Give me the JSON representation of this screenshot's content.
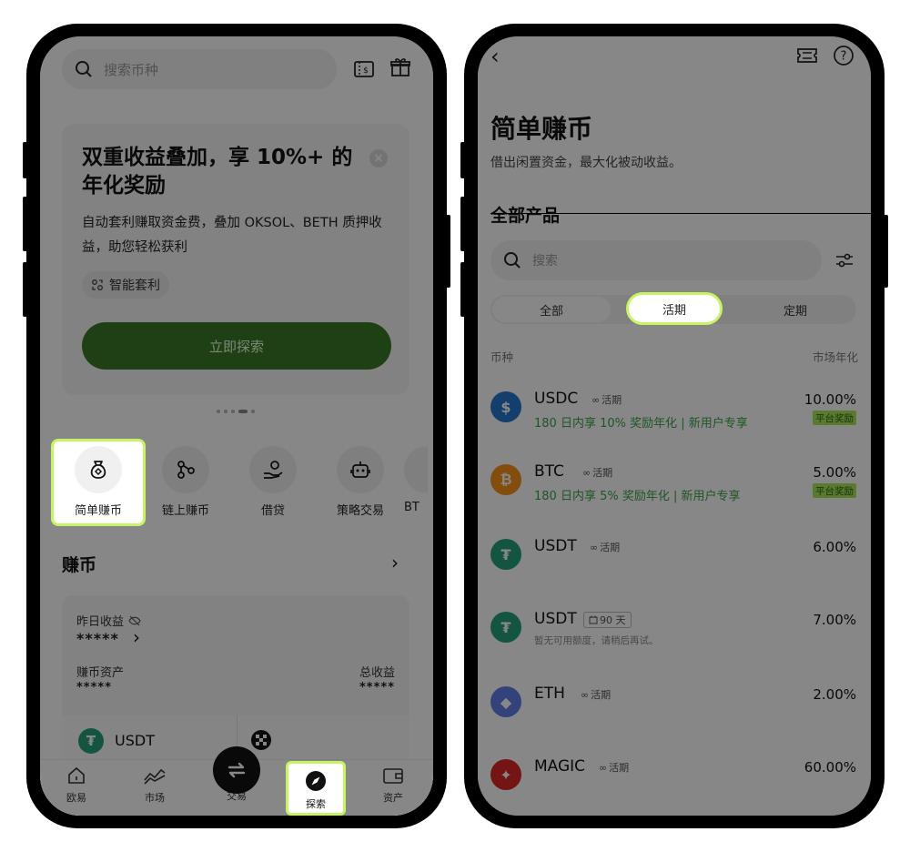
{
  "colors": {
    "highlight": "#c7f464",
    "brand_green": "#3c7a26",
    "green_text": "#3ba24b",
    "reward_bg": "#a6e85a",
    "usdc": "#2775ca",
    "btc": "#f7931a",
    "usdt": "#26a17b",
    "eth": "#627eea",
    "magic": "#dc2626"
  },
  "left": {
    "search": {
      "placeholder": "搜索币种",
      "icon": "search-icon"
    },
    "top_icons": [
      "voucher-icon",
      "gift-icon"
    ],
    "promo": {
      "title": "双重收益叠加，享 10%+ 的年化奖励",
      "desc": "自动套利赚取资金费，叠加 OKSOL、BETH 质押收益，助您轻松获利",
      "tag": "智能套利",
      "cta": "立即探索"
    },
    "features": [
      {
        "label": "简单赚币",
        "icon": "money-bag-icon"
      },
      {
        "label": "链上赚币",
        "icon": "chain-nodes-icon"
      },
      {
        "label": "借贷",
        "icon": "coin-hand-icon"
      },
      {
        "label": "策略交易",
        "icon": "robot-icon"
      },
      {
        "label": "BT"
      }
    ],
    "section": {
      "title": "赚币"
    },
    "card": {
      "yesterday_label": "昨日收益",
      "yesterday_value": "*****",
      "assets_label": "赚币资产",
      "assets_value": "*****",
      "total_label": "总收益",
      "total_value": "*****",
      "coin": "USDT"
    },
    "tabs": [
      {
        "label": "欧易",
        "icon": "home-icon"
      },
      {
        "label": "市场",
        "icon": "market-chart-icon"
      },
      {
        "label": "交易",
        "icon": "swap-icon"
      },
      {
        "label": "探索",
        "icon": "compass-icon"
      },
      {
        "label": "资产",
        "icon": "wallet-icon"
      }
    ]
  },
  "right": {
    "title": "简单赚币",
    "subtitle": "借出闲置资金，最大化被动收益。",
    "section": "全部产品",
    "search": {
      "placeholder": "搜索"
    },
    "segments": [
      "全部",
      "活期",
      "定期"
    ],
    "col_left": "币种",
    "col_right": "市场年化",
    "products": [
      {
        "name": "USDC",
        "badge": "活期",
        "badge_icon": "infinity-icon",
        "rate": "10.00%",
        "sub": "180 日内享 10% 奖励年化 | 新用户专享",
        "reward": "平台奖励",
        "color": "#2775ca",
        "glyph": "$"
      },
      {
        "name": "BTC",
        "badge": "活期",
        "badge_icon": "infinity-icon",
        "rate": "5.00%",
        "sub": "180 日内享 5% 奖励年化 | 新用户专享",
        "reward": "平台奖励",
        "color": "#f7931a",
        "glyph": "₿"
      },
      {
        "name": "USDT",
        "badge": "活期",
        "badge_icon": "infinity-icon",
        "rate": "6.00%",
        "color": "#26a17b",
        "glyph": "₮"
      },
      {
        "name": "USDT",
        "badge": "90 天",
        "badge_icon": "calendar-icon",
        "rate": "7.00%",
        "sub": "暂无可用额度，请稍后再试。",
        "color": "#26a17b",
        "glyph": "₮"
      },
      {
        "name": "ETH",
        "badge": "活期",
        "badge_icon": "infinity-icon",
        "rate": "2.00%",
        "color": "#627eea",
        "glyph": "◆"
      },
      {
        "name": "MAGIC",
        "badge": "活期",
        "badge_icon": "infinity-icon",
        "rate": "60.00%",
        "color": "#dc2626",
        "glyph": "✦"
      }
    ]
  }
}
